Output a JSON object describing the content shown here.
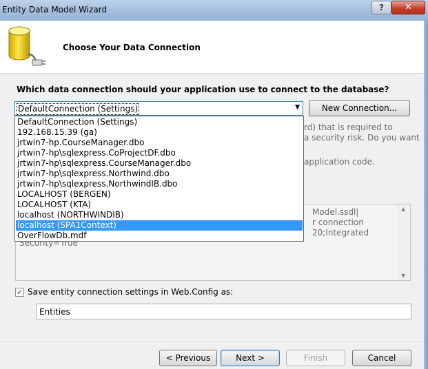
{
  "window": {
    "title": "Entity Data Model Wizard",
    "help": "?",
    "close": "✕"
  },
  "header": {
    "title": "Choose Your Data Connection",
    "icon": "database-plug-icon"
  },
  "question": "Which data connection should your application use to connect to the database?",
  "combo": {
    "selected": "DefaultConnection (Settings)"
  },
  "new_connection_label": "New Connection...",
  "background_text": {
    "line1": "rd) that is required to",
    "line2": "a security risk. Do you want",
    "line3": "application code."
  },
  "connection_string": {
    "line1": "Model.ssdl|",
    "line2": "r connection",
    "line3": "20;Integrated",
    "line4": "Security=True"
  },
  "dropdown_items": [
    "DefaultConnection (Settings)",
    "192.168.15.39 (ga)",
    "jrtwin7-hp.CourseManager.dbo",
    "jrtwin7-hp\\sqlexpress.CoProjectDF.dbo",
    "jrtwin7-hp\\sqlexpress.CourseManager.dbo",
    "jrtwin7-hp\\sqlexpress.Northwind.dbo",
    "jrtwin7-hp\\sqlexpress.NorthwindIB.dbo",
    "LOCALHOST (BERGEN)",
    "LOCALHOST (KTA)",
    "localhost (NORTHWINDIB)",
    "localhost (SPA1Context)",
    "OverFlowDb.mdf"
  ],
  "dropdown_highlighted_index": 10,
  "save_settings": {
    "checked": true,
    "label": "Save entity connection settings in Web.Config as:",
    "check": "✓"
  },
  "entity_name": "Entities",
  "buttons": {
    "previous": "< Previous",
    "next": "Next >",
    "finish": "Finish",
    "cancel": "Cancel"
  },
  "colors": {
    "highlight": "#3399ff",
    "title_bar": "#a3bfdc",
    "close": "#c7402b"
  }
}
